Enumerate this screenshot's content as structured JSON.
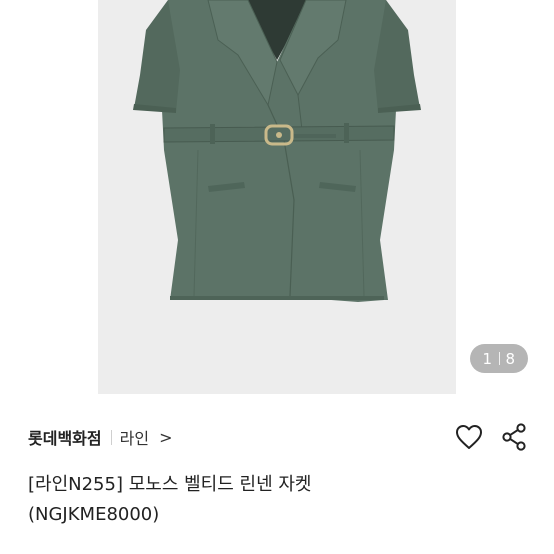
{
  "gallery": {
    "current": "1",
    "total": "8",
    "icon": "jacket-photo"
  },
  "brand": {
    "store": "롯데백화점",
    "name": "라인",
    "chevron": ">"
  },
  "actions": {
    "like_icon": "heart-icon",
    "share_icon": "share-icon"
  },
  "product": {
    "title_line1": "[라인N255] 모노스 벨티드 린넨 자켓",
    "title_line2": "(NGJKME8000)"
  },
  "colors": {
    "jacket": "#5b7265",
    "panel": "#ededed",
    "buckle": "#c9b98a"
  }
}
